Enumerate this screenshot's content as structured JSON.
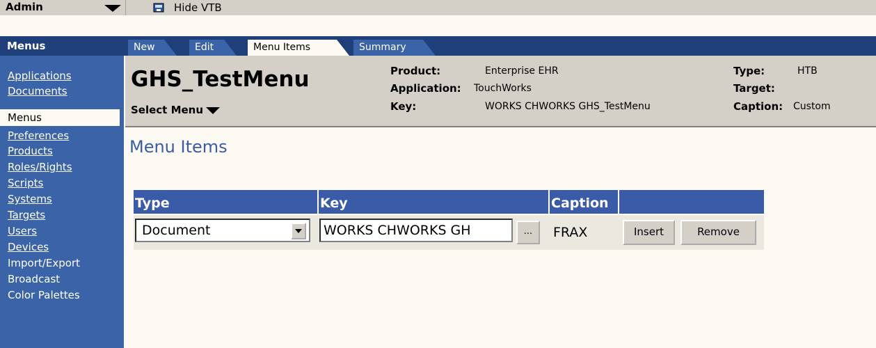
{
  "topbar": {
    "admin_label": "Admin",
    "hide_label": "Hide VTB"
  },
  "nav": {
    "header": "Menus",
    "tabs": [
      {
        "label": "New"
      },
      {
        "label": "Edit"
      },
      {
        "label": "Menu Items",
        "active": true
      },
      {
        "label": "Summary"
      }
    ]
  },
  "sidebar": {
    "items": [
      {
        "label": "Applications"
      },
      {
        "label": "Documents"
      },
      {
        "label": "Menus",
        "selected": true
      },
      {
        "label": "Preferences"
      },
      {
        "label": "Products"
      },
      {
        "label": "Roles/Rights"
      },
      {
        "label": "Scripts"
      },
      {
        "label": "Systems"
      },
      {
        "label": "Targets"
      },
      {
        "label": "Users"
      },
      {
        "label": "Devices"
      },
      {
        "label": "Import/Export"
      },
      {
        "label": "Broadcast"
      },
      {
        "label": "Color Palettes"
      }
    ]
  },
  "header": {
    "menu_name": "GHS_TestMenu",
    "select_menu": "Select Menu",
    "product_label": "Product:",
    "product_value": "Enterprise EHR",
    "application_label": "Application:",
    "application_value": "TouchWorks",
    "key_label": "Key:",
    "key_value": "WORKS CHWORKS GHS_TestMenu",
    "type_label": "Type:",
    "type_value": "HTB",
    "target_label": "Target:",
    "target_value": "",
    "caption_label": "Caption:",
    "caption_value": "Custom"
  },
  "content": {
    "section_title": "Menu Items",
    "columns": [
      "Type",
      "Key",
      "Caption",
      ""
    ],
    "row": {
      "type": "Document",
      "key": "WORKS CHWORKS GH",
      "ellipsis": "...",
      "caption": "FRAX",
      "insert": "Insert",
      "remove": "Remove"
    }
  },
  "colors": {
    "navy": "#1e3f7a",
    "blue": "#3a63a8",
    "panel": "#d4d0c8",
    "page": "#fdf9f3"
  }
}
